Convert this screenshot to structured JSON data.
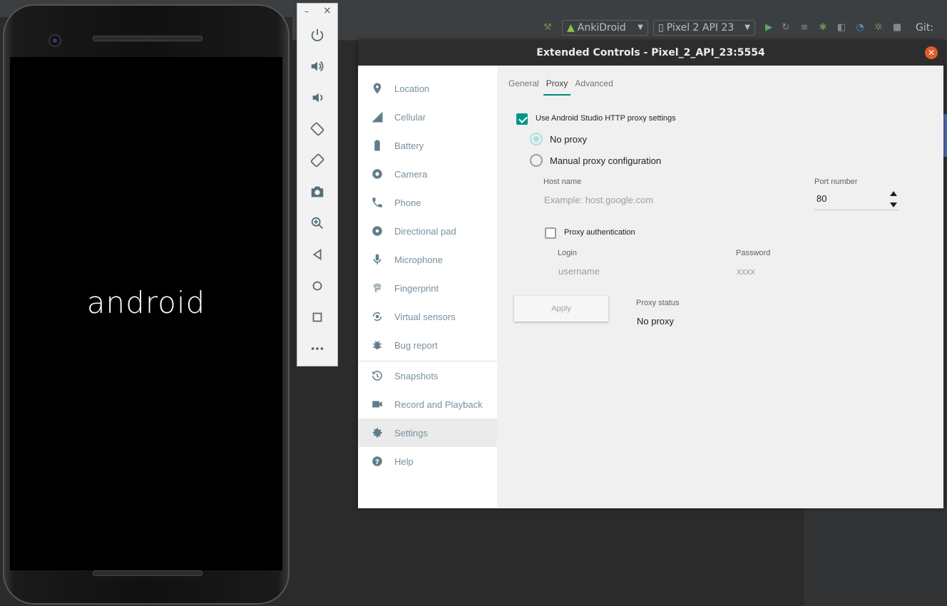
{
  "ide": {
    "run_config": "AnkiDroid",
    "device": "Pixel 2 API 23",
    "git_label": "Git:"
  },
  "phone": {
    "boot_text": "android"
  },
  "emulator_toolbar": {
    "minimize": "–",
    "close": "×",
    "buttons": [
      "power-icon",
      "volume-up-icon",
      "volume-down-icon",
      "rotate-left-icon",
      "rotate-right-icon",
      "camera-icon",
      "zoom-icon",
      "back-icon",
      "home-icon",
      "overview-icon",
      "more-icon"
    ]
  },
  "extended_controls": {
    "title": "Extended Controls - Pixel_2_API_23:5554",
    "sidebar": [
      {
        "label": "Location",
        "icon": "location-icon"
      },
      {
        "label": "Cellular",
        "icon": "cellular-icon"
      },
      {
        "label": "Battery",
        "icon": "battery-icon"
      },
      {
        "label": "Camera",
        "icon": "camera-icon"
      },
      {
        "label": "Phone",
        "icon": "phone-icon"
      },
      {
        "label": "Directional pad",
        "icon": "dpad-icon"
      },
      {
        "label": "Microphone",
        "icon": "microphone-icon"
      },
      {
        "label": "Fingerprint",
        "icon": "fingerprint-icon"
      },
      {
        "label": "Virtual sensors",
        "icon": "sensors-icon"
      },
      {
        "label": "Bug report",
        "icon": "bug-icon"
      },
      {
        "label": "Snapshots",
        "icon": "history-icon"
      },
      {
        "label": "Record and Playback",
        "icon": "videocam-icon"
      },
      {
        "label": "Settings",
        "icon": "gear-icon",
        "active": true
      },
      {
        "label": "Help",
        "icon": "help-icon"
      }
    ],
    "tabs": [
      "General",
      "Proxy",
      "Advanced"
    ],
    "active_tab": "Proxy",
    "proxy": {
      "use_studio_label": "Use Android Studio HTTP proxy settings",
      "use_studio_checked": true,
      "no_proxy_label": "No proxy",
      "manual_label": "Manual proxy configuration",
      "host_label": "Host name",
      "host_placeholder": "Example: host.google.com",
      "port_label": "Port number",
      "port_value": "80",
      "auth_label": "Proxy authentication",
      "auth_checked": false,
      "login_label": "Login",
      "login_placeholder": "username",
      "password_label": "Password",
      "password_placeholder": "xxxx",
      "apply_label": "Apply",
      "status_label": "Proxy status",
      "status_value": "No proxy"
    }
  }
}
